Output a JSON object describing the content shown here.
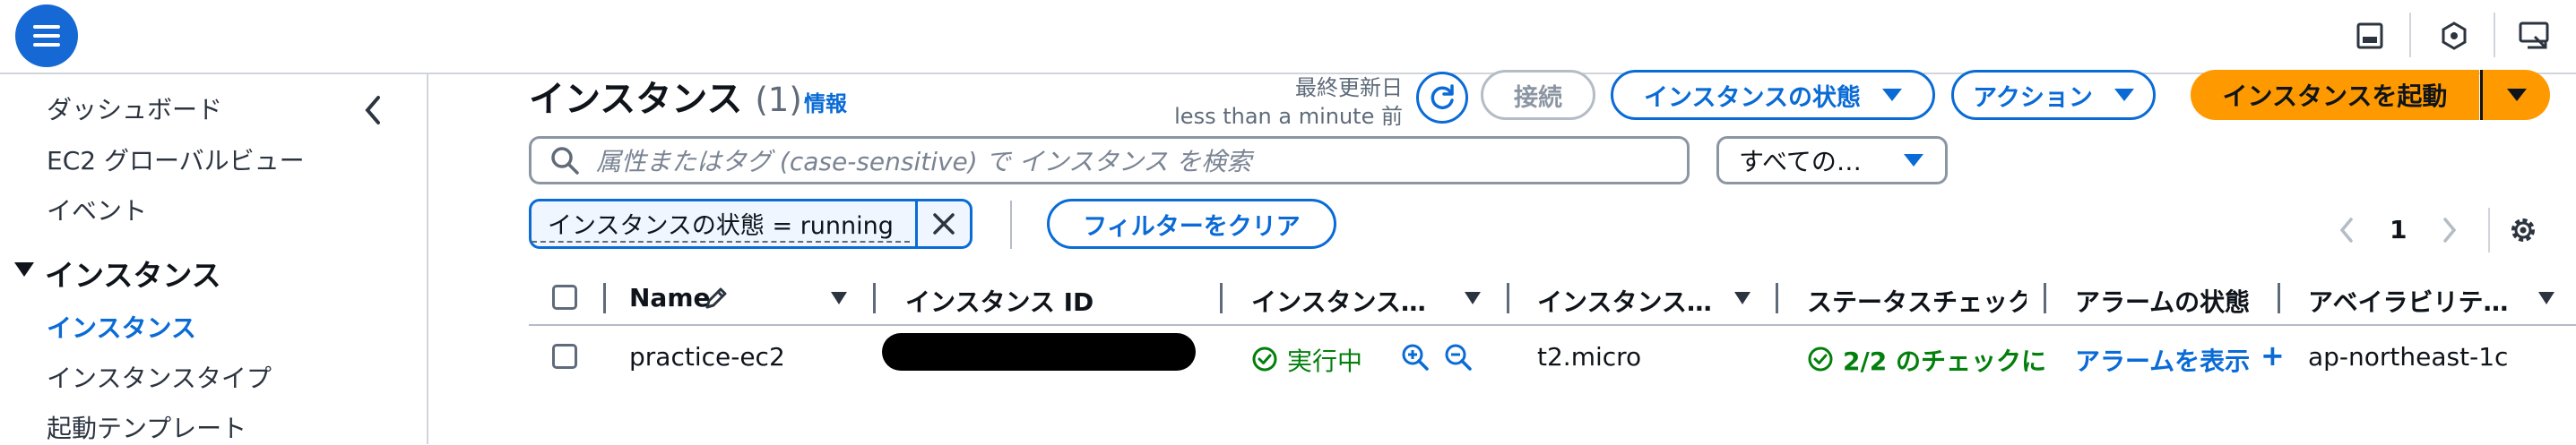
{
  "topbar": {
    "menu_icon": "hamburger-menu-icon",
    "icons": [
      "panel-icon",
      "notifications-icon",
      "screen-share-icon"
    ]
  },
  "sidebar": {
    "items_top": [
      {
        "label": "ダッシュボード"
      },
      {
        "label": "EC2 グローバルビュー"
      },
      {
        "label": "イベント"
      }
    ],
    "section_label": "インスタンス",
    "items_section": [
      {
        "label": "インスタンス",
        "active": true
      },
      {
        "label": "インスタンスタイプ"
      },
      {
        "label": "起動テンプレート"
      }
    ]
  },
  "main": {
    "title": "インスタンス",
    "count": "(1)",
    "info_link": "情報",
    "last_updated_label": "最終更新日",
    "last_updated_value": "less than a minute 前",
    "connect_label": "接続",
    "instance_state_label": "インスタンスの状態",
    "actions_label": "アクション",
    "launch_label": "インスタンスを起動",
    "search_placeholder": "属性またはタグ (case-sensitive) で インスタンス を検索",
    "select_value": "すべての…",
    "filter_token": "インスタンスの状態 = running",
    "clear_filters_label": "フィルターをクリア",
    "page_number": "1"
  },
  "table": {
    "columns": [
      "Name",
      "インスタンス ID",
      "インスタンス…",
      "インスタンス…",
      "ステータスチェック",
      "アラームの状態",
      "アベイラビリテ…"
    ],
    "rows": [
      {
        "name": "practice-ec2",
        "instance_id": "",
        "state": "実行中",
        "type": "t2.micro",
        "status_check": "2/2 のチェックに",
        "alarm": "アラームを表示",
        "alarm_plus": "+",
        "az": "ap-northeast-1c"
      }
    ]
  },
  "colors": {
    "primary_blue": "#0a6bd6",
    "launch_orange": "#ff9900",
    "success_green": "#037f0c"
  }
}
